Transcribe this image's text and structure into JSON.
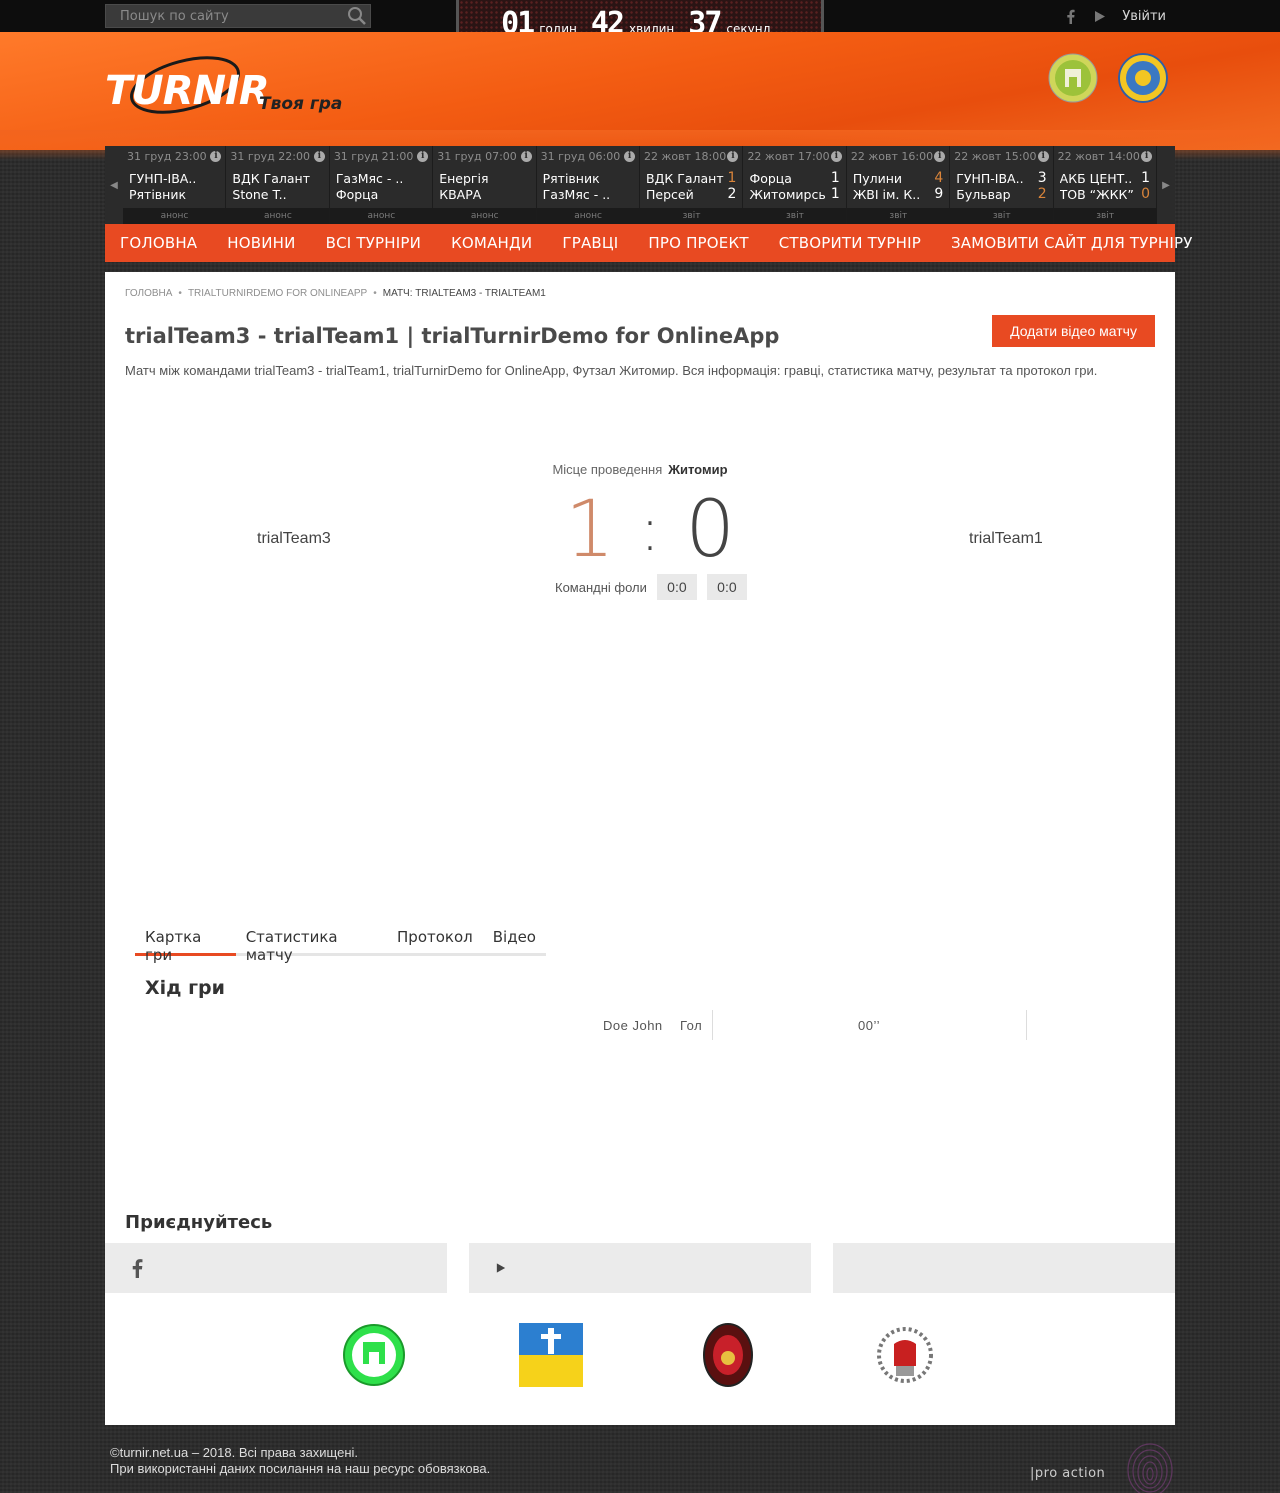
{
  "search": {
    "placeholder": "Пошук по сайту"
  },
  "top": {
    "login": "Увійти"
  },
  "timer": {
    "hours": "01",
    "hours_label": "годин",
    "minutes": "42",
    "minutes_label": "хвилин",
    "seconds": "37",
    "seconds_label": "секунд"
  },
  "brand": {
    "name": "TURNIR",
    "tagline": "Твоя гра"
  },
  "strip": {
    "matches": [
      {
        "date": "31 груд 23:00",
        "team1": "ГУНП-ІВА..",
        "team2": "Рятівник",
        "score1": "",
        "score2": "",
        "status": "анонс"
      },
      {
        "date": "31 груд 22:00",
        "team1": "ВДК Галант",
        "team2": "Stone T..",
        "score1": "",
        "score2": "",
        "status": "анонс"
      },
      {
        "date": "31 груд 21:00",
        "team1": "ГазМяс - ..",
        "team2": "Форца",
        "score1": "",
        "score2": "",
        "status": "анонс"
      },
      {
        "date": "31 груд 07:00",
        "team1": "Енергія",
        "team2": "КВАРА",
        "score1": "",
        "score2": "",
        "status": "анонс"
      },
      {
        "date": "31 груд 06:00",
        "team1": "Рятівник",
        "team2": "ГазМяс - ..",
        "score1": "",
        "score2": "",
        "status": "анонс"
      },
      {
        "date": "22 жовт 18:00",
        "team1": "ВДК Галант",
        "team2": "Персей",
        "score1": "1",
        "score2": "2",
        "status": "звіт"
      },
      {
        "date": "22 жовт 17:00",
        "team1": "Форца",
        "team2": "Житомирсь",
        "score1": "1",
        "score2": "1",
        "status": "звіт"
      },
      {
        "date": "22 жовт 16:00",
        "team1": "Пулини",
        "team2": "ЖВІ ім. К..",
        "score1": "4",
        "score2": "9",
        "status": "звіт"
      },
      {
        "date": "22 жовт 15:00",
        "team1": "ГУНП-ІВА..",
        "team2": "Бульвар",
        "score1": "3",
        "score2": "2",
        "status": "звіт"
      },
      {
        "date": "22 жовт 14:00",
        "team1": "АКБ ЦЕНТ..",
        "team2": "ТОВ “ЖКК”",
        "score1": "1",
        "score2": "0",
        "status": "звіт"
      }
    ]
  },
  "nav": [
    "Головна",
    "Новини",
    "Всі турніри",
    "Команди",
    "Гравці",
    "Про проект",
    "Створити турнір",
    "Замовити сайт для турніру"
  ],
  "breadcrumb": {
    "home": "Головна",
    "tournament": "trialTurnirDemo for OnlineApp",
    "current": "Матч: trialTeam3 - trialTeam1"
  },
  "page": {
    "title": "trialTeam3 - trialTeam1 | trialTurnirDemo for OnlineApp",
    "add_video": "Додати відео матчу",
    "description": "Матч між командами trialTeam3 - trialTeam1, trialTurnirDemo for OnlineApp, Футзал Житомир. Вся інформація: гравці, статистика матчу, результат та протокол гри."
  },
  "match": {
    "venue_label": "Місце проведення",
    "venue": "Житомир",
    "home": "trialTeam3",
    "away": "trialTeam1",
    "home_score": "1",
    "separator": ":",
    "away_score": "0",
    "fouls_label": "Командні фоли",
    "fouls_home": "0:0",
    "fouls_away": "0:0"
  },
  "tabs": [
    "Картка гри",
    "Статистика матчу",
    "Протокол",
    "Відео"
  ],
  "game": {
    "title": "Хід гри",
    "event": {
      "player": "Doe John",
      "type": "Гол",
      "time": "00’’"
    }
  },
  "join": {
    "title": "Приєднуйтесь"
  },
  "footer": {
    "copyright": "©turnir.net.ua – 2018. Всі права захищені.",
    "notice": "При використанні даних посилання на наш ресурс обовязкова.",
    "dev": "|pro action"
  },
  "colors": {
    "accent": "#e84a22",
    "header": "#f35c12",
    "score_home": "#cf8a6a"
  }
}
